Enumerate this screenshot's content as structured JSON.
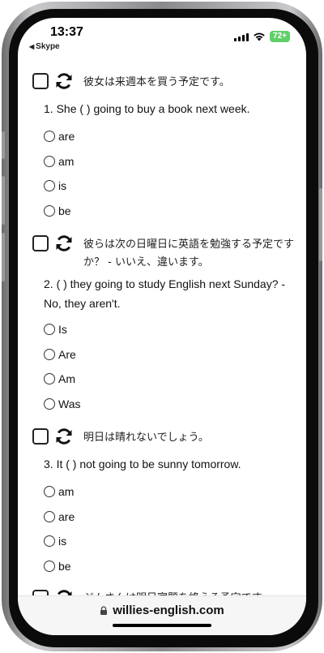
{
  "status": {
    "time": "13:37",
    "back_app": "Skype",
    "battery": "72+"
  },
  "questions": [
    {
      "jp": "彼女は来週本を買う予定です。",
      "en": "1. She ( ) going to buy a book next week.",
      "options": [
        "are",
        "am",
        "is",
        "be"
      ]
    },
    {
      "jp": "彼らは次の日曜日に英語を勉強する予定ですか？ - いいえ、違います。",
      "en": "2. ( ) they going to study English next Sunday? - No, they aren't.",
      "options": [
        "Is",
        "Are",
        "Am",
        "Was"
      ]
    },
    {
      "jp": "明日は晴れないでしょう。",
      "en": "3. It ( ) not going to be sunny tomorrow.",
      "options": [
        "am",
        "are",
        "is",
        "be"
      ]
    },
    {
      "jp": "ジムさんは明日宿題を終える予定です。"
    }
  ],
  "url": "willies-english.com"
}
